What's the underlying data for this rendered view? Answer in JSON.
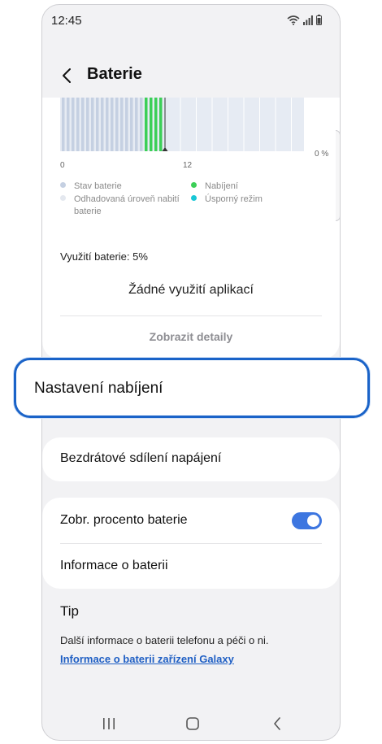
{
  "status_bar": {
    "time": "12:45"
  },
  "header": {
    "title": "Baterie"
  },
  "chart_data": {
    "type": "bar",
    "x_ticks": [
      "0",
      "12"
    ],
    "y_ticks": [
      "0 %"
    ],
    "series": [
      {
        "name": "Stav baterie",
        "color": "#c5d0e2"
      },
      {
        "name": "Nabíjení",
        "color": "#3ccf57"
      }
    ],
    "legend": [
      {
        "label": "Stav baterie",
        "color": "#c5d0e2"
      },
      {
        "label": "Odhadovaná úroveň nabití baterie",
        "color": "#e4e8ef"
      },
      {
        "label": "Nabíjení",
        "color": "#3ccf57"
      },
      {
        "label": "Úsporný režim",
        "color": "#19c7d6"
      }
    ]
  },
  "legend": {
    "battery_state": "Stav baterie",
    "estimated_line1": "Odhadovaná úroveň nabití",
    "estimated_line2": "baterie",
    "charging": "Nabíjení",
    "power_saving": "Úsporný režim"
  },
  "usage": {
    "label": "Využití baterie: 5%",
    "no_app_usage": "Žádné využití aplikací",
    "show_details": "Zobrazit detaily"
  },
  "settings": {
    "charging_settings": "Nastavení nabíjení",
    "wireless_power_sharing": "Bezdrátové sdílení napájení",
    "show_battery_percent": "Zobr. procento baterie",
    "show_battery_percent_on": true,
    "battery_info": "Informace o baterii"
  },
  "tip": {
    "title": "Tip",
    "text": "Další informace o baterii telefonu a péči o ni.",
    "link": "Informace o baterii zařízení Galaxy"
  },
  "colors": {
    "accent": "#1a63c8",
    "toggle": "#3d76e0",
    "link": "#1f5fc4"
  }
}
